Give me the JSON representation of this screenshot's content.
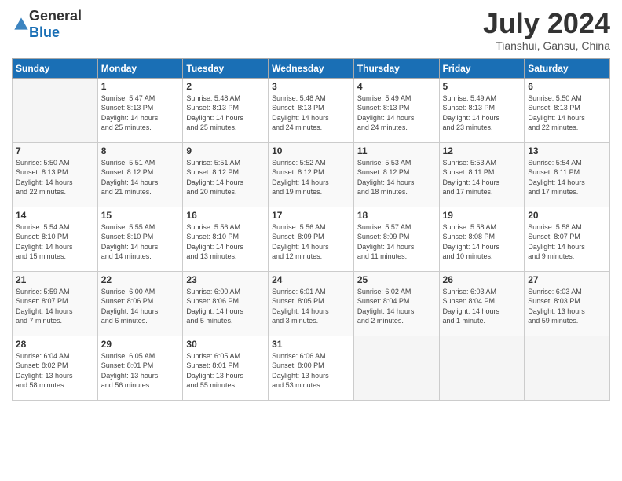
{
  "header": {
    "logo_general": "General",
    "logo_blue": "Blue",
    "month_title": "July 2024",
    "subtitle": "Tianshui, Gansu, China"
  },
  "weekdays": [
    "Sunday",
    "Monday",
    "Tuesday",
    "Wednesday",
    "Thursday",
    "Friday",
    "Saturday"
  ],
  "weeks": [
    [
      {
        "day": "",
        "info": ""
      },
      {
        "day": "1",
        "info": "Sunrise: 5:47 AM\nSunset: 8:13 PM\nDaylight: 14 hours\nand 25 minutes."
      },
      {
        "day": "2",
        "info": "Sunrise: 5:48 AM\nSunset: 8:13 PM\nDaylight: 14 hours\nand 25 minutes."
      },
      {
        "day": "3",
        "info": "Sunrise: 5:48 AM\nSunset: 8:13 PM\nDaylight: 14 hours\nand 24 minutes."
      },
      {
        "day": "4",
        "info": "Sunrise: 5:49 AM\nSunset: 8:13 PM\nDaylight: 14 hours\nand 24 minutes."
      },
      {
        "day": "5",
        "info": "Sunrise: 5:49 AM\nSunset: 8:13 PM\nDaylight: 14 hours\nand 23 minutes."
      },
      {
        "day": "6",
        "info": "Sunrise: 5:50 AM\nSunset: 8:13 PM\nDaylight: 14 hours\nand 22 minutes."
      }
    ],
    [
      {
        "day": "7",
        "info": "Sunrise: 5:50 AM\nSunset: 8:13 PM\nDaylight: 14 hours\nand 22 minutes."
      },
      {
        "day": "8",
        "info": "Sunrise: 5:51 AM\nSunset: 8:12 PM\nDaylight: 14 hours\nand 21 minutes."
      },
      {
        "day": "9",
        "info": "Sunrise: 5:51 AM\nSunset: 8:12 PM\nDaylight: 14 hours\nand 20 minutes."
      },
      {
        "day": "10",
        "info": "Sunrise: 5:52 AM\nSunset: 8:12 PM\nDaylight: 14 hours\nand 19 minutes."
      },
      {
        "day": "11",
        "info": "Sunrise: 5:53 AM\nSunset: 8:12 PM\nDaylight: 14 hours\nand 18 minutes."
      },
      {
        "day": "12",
        "info": "Sunrise: 5:53 AM\nSunset: 8:11 PM\nDaylight: 14 hours\nand 17 minutes."
      },
      {
        "day": "13",
        "info": "Sunrise: 5:54 AM\nSunset: 8:11 PM\nDaylight: 14 hours\nand 17 minutes."
      }
    ],
    [
      {
        "day": "14",
        "info": "Sunrise: 5:54 AM\nSunset: 8:10 PM\nDaylight: 14 hours\nand 15 minutes."
      },
      {
        "day": "15",
        "info": "Sunrise: 5:55 AM\nSunset: 8:10 PM\nDaylight: 14 hours\nand 14 minutes."
      },
      {
        "day": "16",
        "info": "Sunrise: 5:56 AM\nSunset: 8:10 PM\nDaylight: 14 hours\nand 13 minutes."
      },
      {
        "day": "17",
        "info": "Sunrise: 5:56 AM\nSunset: 8:09 PM\nDaylight: 14 hours\nand 12 minutes."
      },
      {
        "day": "18",
        "info": "Sunrise: 5:57 AM\nSunset: 8:09 PM\nDaylight: 14 hours\nand 11 minutes."
      },
      {
        "day": "19",
        "info": "Sunrise: 5:58 AM\nSunset: 8:08 PM\nDaylight: 14 hours\nand 10 minutes."
      },
      {
        "day": "20",
        "info": "Sunrise: 5:58 AM\nSunset: 8:07 PM\nDaylight: 14 hours\nand 9 minutes."
      }
    ],
    [
      {
        "day": "21",
        "info": "Sunrise: 5:59 AM\nSunset: 8:07 PM\nDaylight: 14 hours\nand 7 minutes."
      },
      {
        "day": "22",
        "info": "Sunrise: 6:00 AM\nSunset: 8:06 PM\nDaylight: 14 hours\nand 6 minutes."
      },
      {
        "day": "23",
        "info": "Sunrise: 6:00 AM\nSunset: 8:06 PM\nDaylight: 14 hours\nand 5 minutes."
      },
      {
        "day": "24",
        "info": "Sunrise: 6:01 AM\nSunset: 8:05 PM\nDaylight: 14 hours\nand 3 minutes."
      },
      {
        "day": "25",
        "info": "Sunrise: 6:02 AM\nSunset: 8:04 PM\nDaylight: 14 hours\nand 2 minutes."
      },
      {
        "day": "26",
        "info": "Sunrise: 6:03 AM\nSunset: 8:04 PM\nDaylight: 14 hours\nand 1 minute."
      },
      {
        "day": "27",
        "info": "Sunrise: 6:03 AM\nSunset: 8:03 PM\nDaylight: 13 hours\nand 59 minutes."
      }
    ],
    [
      {
        "day": "28",
        "info": "Sunrise: 6:04 AM\nSunset: 8:02 PM\nDaylight: 13 hours\nand 58 minutes."
      },
      {
        "day": "29",
        "info": "Sunrise: 6:05 AM\nSunset: 8:01 PM\nDaylight: 13 hours\nand 56 minutes."
      },
      {
        "day": "30",
        "info": "Sunrise: 6:05 AM\nSunset: 8:01 PM\nDaylight: 13 hours\nand 55 minutes."
      },
      {
        "day": "31",
        "info": "Sunrise: 6:06 AM\nSunset: 8:00 PM\nDaylight: 13 hours\nand 53 minutes."
      },
      {
        "day": "",
        "info": ""
      },
      {
        "day": "",
        "info": ""
      },
      {
        "day": "",
        "info": ""
      }
    ]
  ]
}
